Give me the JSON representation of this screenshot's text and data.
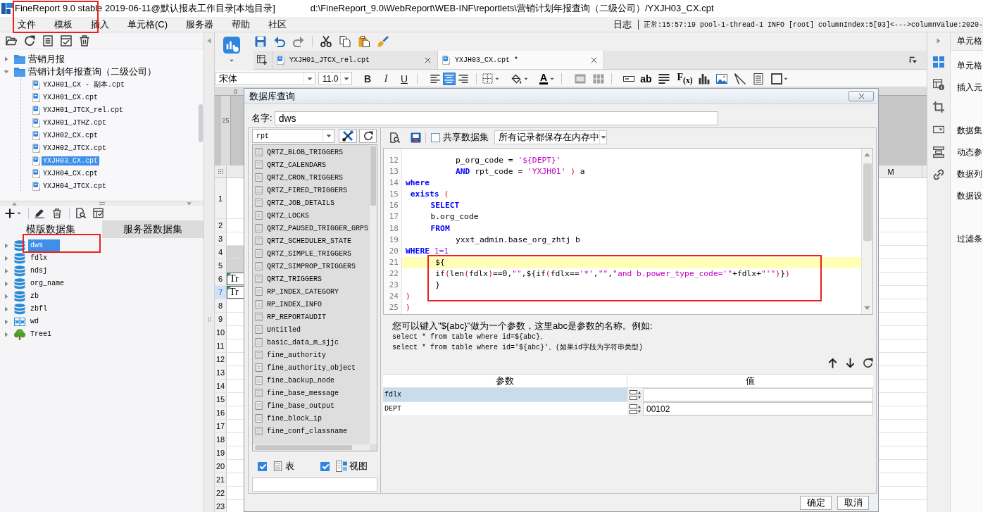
{
  "window": {
    "title": "FineReport 9.0 stable 2019-06-11@默认报表工作目录[本地目录]",
    "path": "d:\\FineReport_9.0\\WebReport\\WEB-INF\\reportlets\\营销计划年报查询（二级公司）/YXJH03_CX.cpt"
  },
  "menu": [
    "文件",
    "模板",
    "插入",
    "单元格(C)",
    "服务器",
    "帮助",
    "社区"
  ],
  "log": {
    "label": "日志",
    "message": "正常:15:57:19 pool-1-thread-1 INFO [root] columnIndex:5[93]<--->columnValue:2020-"
  },
  "file_tree": [
    {
      "label": "营销月报",
      "expanded": false,
      "selected": false
    },
    {
      "label": "营销计划年报查询（二级公司）",
      "expanded": true,
      "selected": false,
      "children": [
        {
          "label": "YXJH01_CX - 副本.cpt",
          "selected": false
        },
        {
          "label": "YXJH01_CX.cpt",
          "selected": false
        },
        {
          "label": "YXJH01_JTCX_rel.cpt",
          "selected": false
        },
        {
          "label": "YXJH01_JTHZ.cpt",
          "selected": false
        },
        {
          "label": "YXJH02_CX.cpt",
          "selected": false
        },
        {
          "label": "YXJH02_JTCX.cpt",
          "selected": false
        },
        {
          "label": "YXJH03_CX.cpt",
          "selected": true
        },
        {
          "label": "YXJH04_CX.cpt",
          "selected": false
        },
        {
          "label": "YXJH04_JTCX.cpt",
          "selected": false
        }
      ]
    }
  ],
  "dataset_tabs": [
    {
      "label": "模版数据集",
      "selected": true
    },
    {
      "label": "服务器数据集",
      "selected": false
    }
  ],
  "datasets": [
    {
      "label": "dws",
      "kind": "database",
      "selected": true
    },
    {
      "label": "fdlx",
      "kind": "database",
      "selected": false
    },
    {
      "label": "ndsj",
      "kind": "database",
      "selected": false
    },
    {
      "label": "org_name",
      "kind": "database",
      "selected": false
    },
    {
      "label": "zb",
      "kind": "database",
      "selected": false
    },
    {
      "label": "zbfl",
      "kind": "database",
      "selected": false
    },
    {
      "label": "wd",
      "kind": "table",
      "selected": false
    },
    {
      "label": "Tree1",
      "kind": "tree",
      "selected": false
    }
  ],
  "editor_tabs": [
    {
      "label": "YXJH01_JTCX_rel.cpt",
      "selected": false
    },
    {
      "label": "YXJH03_CX.cpt *",
      "selected": true
    }
  ],
  "format_toolbar": {
    "font": "宋体",
    "size": "11.0",
    "text_styles": [
      {
        "kind": "bold",
        "label": "B"
      },
      {
        "kind": "italic",
        "label": "I"
      },
      {
        "kind": "underline",
        "label": "U"
      }
    ],
    "alignment": [
      {
        "kind": "left",
        "selected": false
      },
      {
        "kind": "center",
        "selected": true
      },
      {
        "kind": "right",
        "selected": false
      }
    ],
    "font_color_label": "A",
    "text_tool_label": "ab",
    "formula_label": "F$_{(x)}$"
  },
  "sheet": {
    "ruler_top_label": "0",
    "ruler_side_label": "25",
    "column_label": "M",
    "rows": [
      {
        "number": "1",
        "selected": false,
        "shaded": false
      },
      {
        "number": "2",
        "selected": false,
        "shaded": false
      },
      {
        "number": "3",
        "selected": false,
        "shaded": false
      },
      {
        "number": "4",
        "selected": false,
        "shaded": true
      },
      {
        "number": "5",
        "selected": false,
        "shaded": true
      },
      {
        "number": "6",
        "cell": "Tr",
        "selected": false,
        "shaded": false
      },
      {
        "number": "7",
        "cell": "Tr",
        "selected": true,
        "shaded": false
      },
      {
        "number": "8",
        "selected": false,
        "shaded": false
      },
      {
        "number": "9",
        "selected": false,
        "shaded": false
      },
      {
        "number": "10",
        "selected": false,
        "shaded": false
      },
      {
        "number": "11",
        "selected": false,
        "shaded": false
      },
      {
        "number": "12",
        "selected": false,
        "shaded": false
      },
      {
        "number": "13",
        "selected": false,
        "shaded": false
      },
      {
        "number": "14",
        "selected": false,
        "shaded": false
      },
      {
        "number": "15",
        "selected": false,
        "shaded": false
      },
      {
        "number": "16",
        "selected": false,
        "shaded": false
      },
      {
        "number": "17",
        "selected": false,
        "shaded": false
      },
      {
        "number": "18",
        "selected": false,
        "shaded": false
      },
      {
        "number": "19",
        "selected": false,
        "shaded": false
      },
      {
        "number": "20",
        "selected": false,
        "shaded": false
      },
      {
        "number": "21",
        "selected": false,
        "shaded": false
      },
      {
        "number": "22",
        "selected": false,
        "shaded": false
      },
      {
        "number": "23",
        "selected": false,
        "shaded": false
      }
    ]
  },
  "side_tabs": [
    {
      "kind": "cell-style",
      "selected": true
    },
    {
      "kind": "cell-element",
      "selected": false
    },
    {
      "kind": "frame",
      "selected": false
    },
    {
      "kind": "widget",
      "selected": false
    },
    {
      "kind": "layers",
      "selected": false
    },
    {
      "kind": "link",
      "selected": false
    }
  ],
  "property_panel": {
    "title": "单元格",
    "groups": [
      {
        "items": [
          "单元格",
          "插入元"
        ]
      },
      {
        "items": [
          "数据集",
          "动态参",
          "数据列",
          "数据设"
        ]
      },
      {
        "items": [
          "过滤条"
        ]
      }
    ]
  },
  "dialog": {
    "title": "数据库查询",
    "name_label": "名字:",
    "name_value": "dws",
    "connection": "rpt",
    "tables": [
      "QRTZ_BLOB_TRIGGERS",
      "QRTZ_CALENDARS",
      "QRTZ_CRON_TRIGGERS",
      "QRTZ_FIRED_TRIGGERS",
      "QRTZ_JOB_DETAILS",
      "QRTZ_LOCKS",
      "QRTZ_PAUSED_TRIGGER_GRPS",
      "QRTZ_SCHEDULER_STATE",
      "QRTZ_SIMPLE_TRIGGERS",
      "QRTZ_SIMPROP_TRIGGERS",
      "QRTZ_TRIGGERS",
      "RP_INDEX_CATEGORY",
      "RP_INDEX_INFO",
      "RP_REPORTAUDIT",
      "Untitled",
      "basic_data_m_sjjc",
      "fine_authority",
      "fine_authority_object",
      "fine_backup_node",
      "fine_base_message",
      "fine_base_output",
      "fine_block_ip",
      "fine_conf_classname"
    ],
    "show_tables": {
      "label": "表",
      "checked": true
    },
    "show_views": {
      "label": "视图",
      "checked": true
    },
    "share_dataset": {
      "label": "共享数据集",
      "checked": false
    },
    "storage_mode": "所有记录都保存在内存中",
    "sql_lines": [
      {
        "number": "12",
        "current": false,
        "tokens": [
          {
            "text": "\t\tp_org_code = ",
            "kind": "plain"
          },
          {
            "text": "'${DEPT}'",
            "kind": "string"
          }
        ]
      },
      {
        "number": "13",
        "current": false,
        "tokens": [
          {
            "text": "\t\tAND",
            "kind": "keyword"
          },
          {
            "text": " rpt_code = ",
            "kind": "plain"
          },
          {
            "text": "'YXJH01'",
            "kind": "string"
          },
          {
            "text": " )",
            "kind": "paren"
          },
          {
            "text": " a",
            "kind": "plain"
          }
        ]
      },
      {
        "number": "14",
        "current": false,
        "tokens": [
          {
            "text": "where",
            "kind": "keyword"
          }
        ]
      },
      {
        "number": "15",
        "current": false,
        "tokens": [
          {
            "text": " exists",
            "kind": "keyword"
          },
          {
            "text": " (",
            "kind": "paren"
          }
        ]
      },
      {
        "number": "16",
        "current": false,
        "tokens": [
          {
            "text": "\tSELECT",
            "kind": "keyword"
          }
        ]
      },
      {
        "number": "17",
        "current": false,
        "tokens": [
          {
            "text": "\tb.org_code",
            "kind": "plain"
          }
        ]
      },
      {
        "number": "18",
        "current": false,
        "tokens": [
          {
            "text": "\tFROM",
            "kind": "keyword"
          }
        ]
      },
      {
        "number": "19",
        "current": false,
        "tokens": [
          {
            "text": "\t\tyxxt_admin.base_org_zhtj b",
            "kind": "plain"
          }
        ]
      },
      {
        "number": "20",
        "current": false,
        "tokens": [
          {
            "text": "WHERE",
            "kind": "keyword"
          },
          {
            "text": " 1=1",
            "kind": "number"
          }
        ]
      },
      {
        "number": "21",
        "current": true,
        "tokens": [
          {
            "text": "\t ${",
            "kind": "plain"
          }
        ]
      },
      {
        "number": "22",
        "current": false,
        "tokens": [
          {
            "text": "\t if",
            "kind": "plain"
          },
          {
            "text": "(",
            "kind": "paren"
          },
          {
            "text": "len",
            "kind": "plain"
          },
          {
            "text": "(",
            "kind": "paren"
          },
          {
            "text": "fdlx",
            "kind": "plain"
          },
          {
            "text": ")",
            "kind": "paren"
          },
          {
            "text": "==0,",
            "kind": "plain"
          },
          {
            "text": "\"\"",
            "kind": "string"
          },
          {
            "text": ",${if",
            "kind": "plain"
          },
          {
            "text": "(",
            "kind": "paren"
          },
          {
            "text": "fdlx==",
            "kind": "plain"
          },
          {
            "text": "'*'",
            "kind": "string"
          },
          {
            "text": ",",
            "kind": "plain"
          },
          {
            "text": "\"\"",
            "kind": "string"
          },
          {
            "text": ",",
            "kind": "plain"
          },
          {
            "text": "\"and b.power_type_code='\"",
            "kind": "string"
          },
          {
            "text": "+fdlx+",
            "kind": "plain"
          },
          {
            "text": "\"'\"",
            "kind": "string"
          },
          {
            "text": ")",
            "kind": "paren"
          },
          {
            "text": "}",
            "kind": "plain"
          },
          {
            "text": ")",
            "kind": "paren"
          }
        ]
      },
      {
        "number": "23",
        "current": false,
        "tokens": [
          {
            "text": "\t }",
            "kind": "plain"
          }
        ]
      },
      {
        "number": "24",
        "current": false,
        "tokens": [
          {
            "text": ")",
            "kind": "paren"
          }
        ]
      },
      {
        "number": "25",
        "current": false,
        "tokens": [
          {
            "text": ")",
            "kind": "paren"
          }
        ]
      }
    ],
    "hint": {
      "intro": "您可以键入\"${abc}\"做为一个参数，这里abc是参数的名称。例如:",
      "examples": [
        "select * from table where id=${abc}。",
        "select * from table where id='${abc}'。(如果id字段为字符串类型)"
      ]
    },
    "params": {
      "columns": [
        "参数",
        "值"
      ],
      "rows": [
        {
          "name": "fdlx",
          "selected": true
        },
        {
          "name": "DEPT",
          "value": "00102",
          "selected": false
        }
      ]
    },
    "buttons": [
      "确定",
      "取消"
    ]
  }
}
